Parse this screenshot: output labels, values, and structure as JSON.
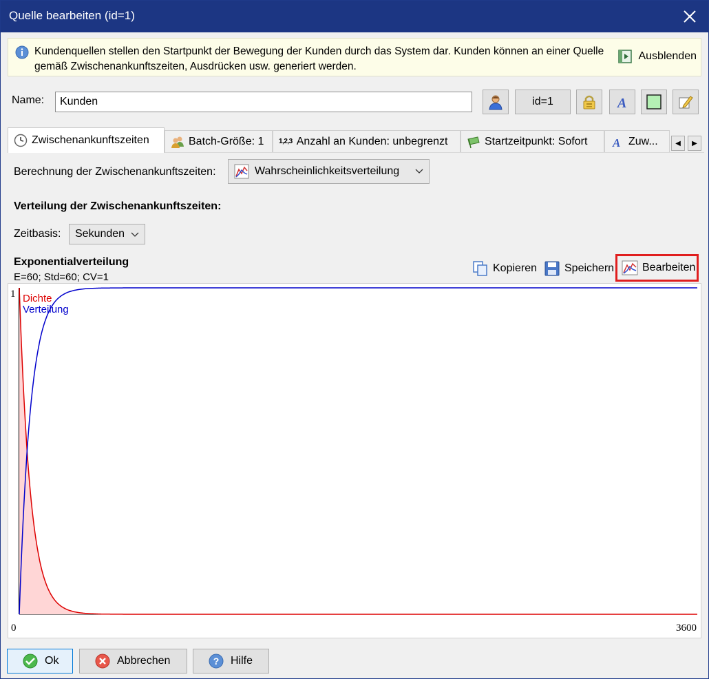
{
  "window": {
    "title": "Quelle bearbeiten (id=1)"
  },
  "info": {
    "text": "Kundenquellen stellen den Startpunkt der Bewegung der Kunden durch das System dar. Kunden können an einer Quelle gemäß Zwischenankunftszeiten, Ausdrücken usw. generiert werden.",
    "hide_label": "Ausblenden"
  },
  "name": {
    "label": "Name:",
    "value": "Kunden",
    "id_label": "id=1"
  },
  "tabs": [
    {
      "label": "Zwischenankunftszeiten"
    },
    {
      "label": "Batch-Größe: 1"
    },
    {
      "label": "Anzahl an Kunden: unbegrenzt",
      "icon_text": "1,2,3"
    },
    {
      "label": "Startzeitpunkt: Sofort"
    },
    {
      "label": "Zuw..."
    }
  ],
  "calc": {
    "label": "Berechnung der Zwischenankunftszeiten:",
    "selected": "Wahrscheinlichkeitsverteilung"
  },
  "distribution": {
    "heading": "Verteilung der Zwischenankunftszeiten:",
    "zeitbasis_label": "Zeitbasis:",
    "zeitbasis_value": "Sekunden",
    "name": "Exponentialverteilung",
    "params": "E=60; Std=60; CV=1",
    "actions": {
      "copy": "Kopieren",
      "save": "Speichern",
      "edit": "Bearbeiten"
    }
  },
  "chart_data": {
    "type": "line",
    "series": [
      {
        "name": "Dichte",
        "color": "#dd0000",
        "function": "exponential-density",
        "mean": 60,
        "fill": "#ffd6d6"
      },
      {
        "name": "Verteilung",
        "color": "#0000cc",
        "function": "exponential-cdf",
        "mean": 60
      }
    ],
    "xlim": [
      0,
      3600
    ],
    "ylim": [
      0,
      1
    ],
    "x_tick_labels": [
      "0",
      "3600"
    ],
    "y_tick_labels": [
      "1"
    ],
    "grid": false,
    "legend": "top-left"
  },
  "footer": {
    "ok": "Ok",
    "cancel": "Abbrechen",
    "help": "Hilfe"
  },
  "colors": {
    "titlebar": "#1c3683",
    "highlight": "#e01e1e"
  }
}
